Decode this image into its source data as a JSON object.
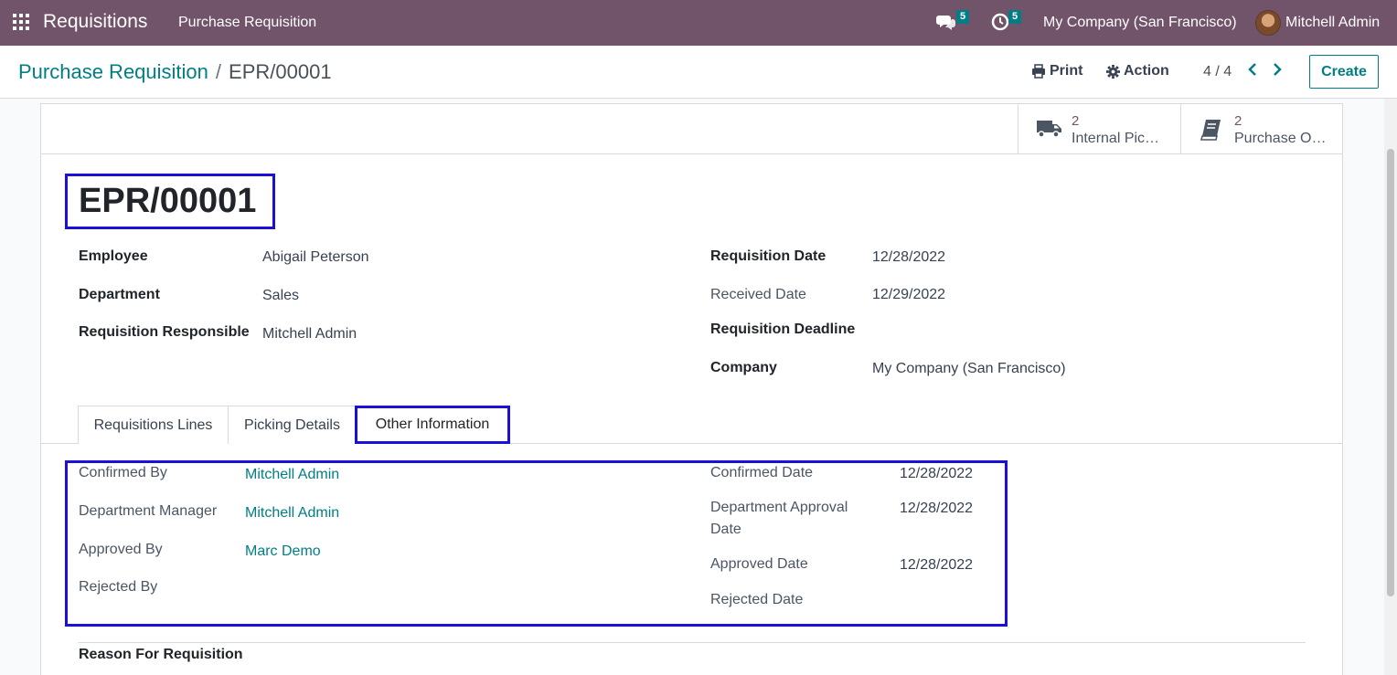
{
  "navbar": {
    "app_name": "Requisitions",
    "menu_item": "Purchase Requisition",
    "messages_count": "5",
    "activities_count": "5",
    "company": "My Company (San Francisco)",
    "user": "Mitchell Admin"
  },
  "control_panel": {
    "breadcrumb_parent": "Purchase Requisition",
    "breadcrumb_separator": "/",
    "breadcrumb_current": "EPR/00001",
    "print_label": "Print",
    "action_label": "Action",
    "pager": "4 / 4",
    "create_label": "Create"
  },
  "smart_buttons": [
    {
      "count": "2",
      "label": "Internal Pic…",
      "icon": "truck-icon"
    },
    {
      "count": "2",
      "label": "Purchase O…",
      "icon": "book-icon"
    }
  ],
  "record": {
    "name": "EPR/00001",
    "left_fields": [
      {
        "label": "Employee",
        "value": "Abigail Peterson"
      },
      {
        "label": "Department",
        "value": "Sales"
      },
      {
        "label": "Requisition Responsible",
        "value": "Mitchell Admin"
      }
    ],
    "right_fields": [
      {
        "label": "Requisition Date",
        "value": "12/28/2022"
      },
      {
        "label": "Received Date",
        "value": "12/29/2022"
      },
      {
        "label": "Requisition Deadline",
        "value": ""
      },
      {
        "label": "Company",
        "value": "My Company (San Francisco)"
      }
    ]
  },
  "tabs": [
    "Requisitions Lines",
    "Picking Details",
    "Other Information"
  ],
  "active_tab": "Other Information",
  "other_info": {
    "left": [
      {
        "label": "Confirmed By",
        "value": "Mitchell Admin"
      },
      {
        "label": "Department Manager",
        "value": "Mitchell Admin"
      },
      {
        "label": "Approved By",
        "value": "Marc Demo"
      },
      {
        "label": "Rejected By",
        "value": ""
      }
    ],
    "right": [
      {
        "label": "Confirmed Date",
        "value": "12/28/2022"
      },
      {
        "label": "Department Approval Date",
        "label_line1": "Department Approval",
        "label_line2": "Date",
        "value": "12/28/2022"
      },
      {
        "label": "Approved Date",
        "value": "12/28/2022"
      },
      {
        "label": "Rejected Date",
        "value": ""
      }
    ],
    "reason_label": "Reason For Requisition"
  },
  "colors": {
    "navbar": "#71536a",
    "accent": "#017e84",
    "highlight": "#1a10d8"
  }
}
